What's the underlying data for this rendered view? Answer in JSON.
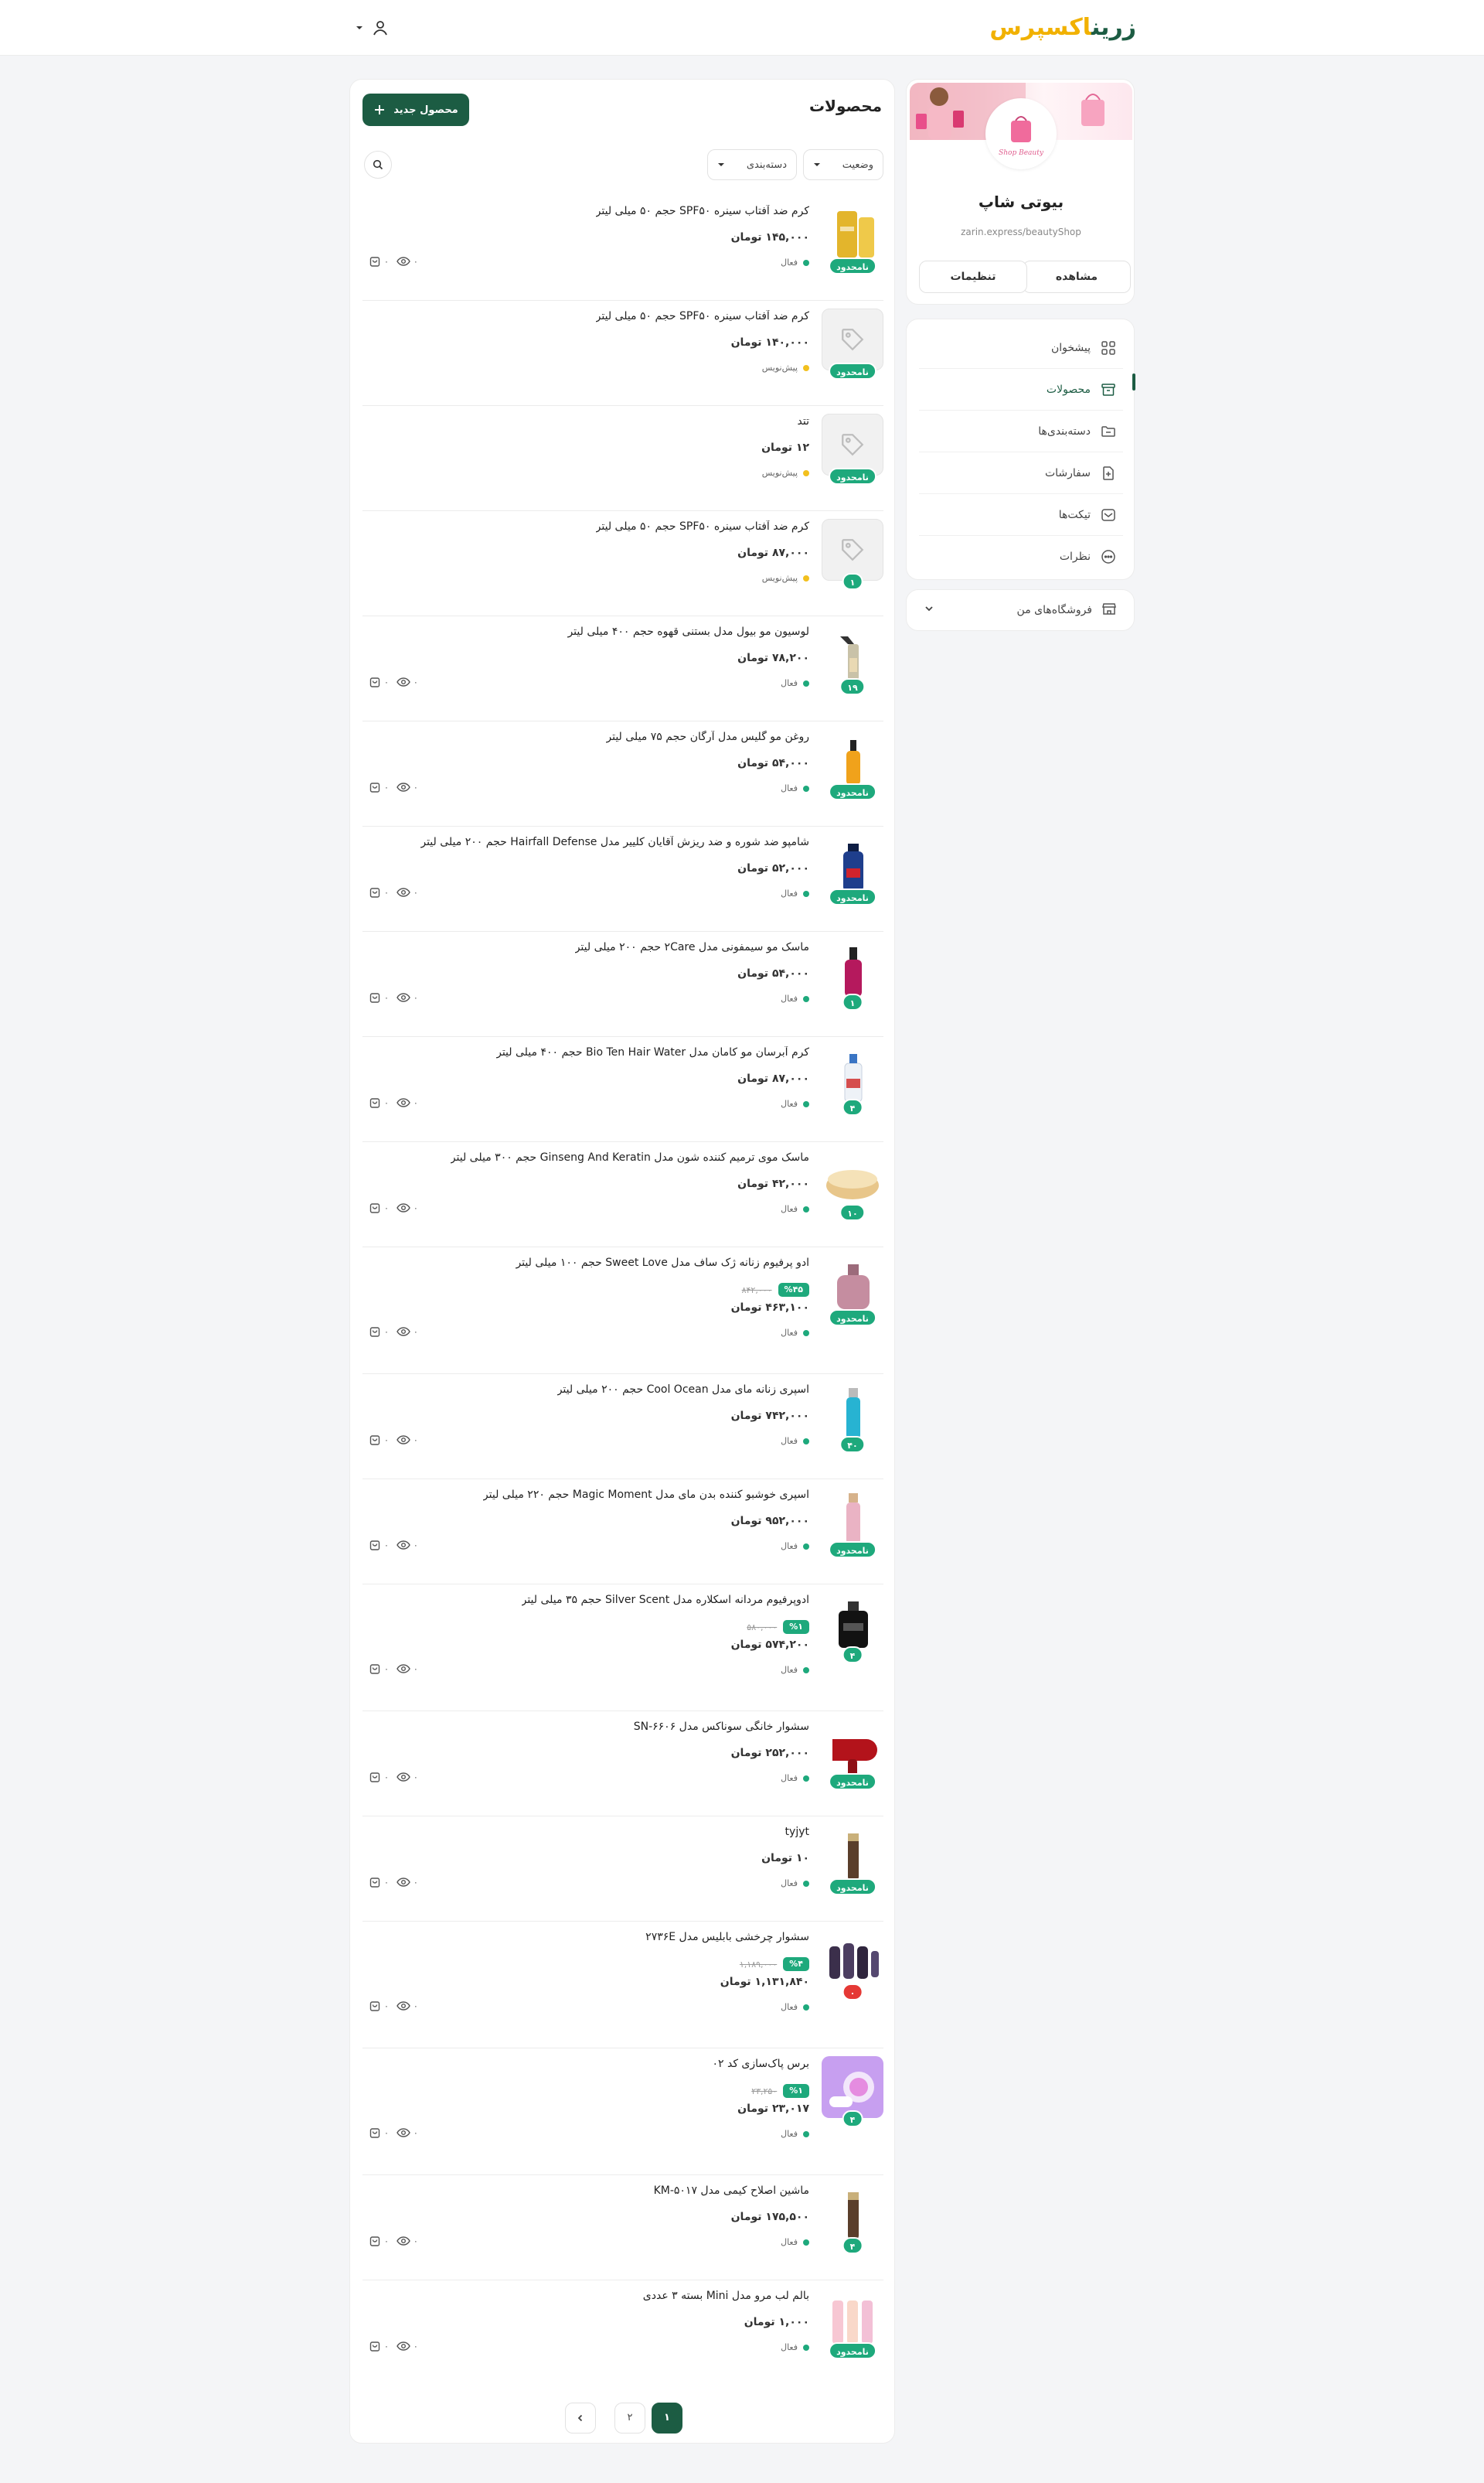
{
  "header": {
    "logo_part1": "زرین",
    "logo_part2": "اکسپرس"
  },
  "store": {
    "name": "بیوتی شاپ",
    "url": "zarin.express/beautyShop",
    "view_label": "مشاهده",
    "settings_label": "تنظیمات",
    "banner_script": "Shop Beauty"
  },
  "nav": {
    "items": [
      {
        "label": "پیشخوان",
        "icon": "grid-icon"
      },
      {
        "label": "محصولات",
        "icon": "box-icon"
      },
      {
        "label": "دسته‌بندی‌ها",
        "icon": "folder-icon"
      },
      {
        "label": "سفارشات",
        "icon": "document-icon"
      },
      {
        "label": "تیکت‌ها",
        "icon": "ticket-icon"
      },
      {
        "label": "نظرات",
        "icon": "comment-icon"
      }
    ],
    "my_stores_label": "فروشگاه‌های من"
  },
  "main": {
    "title": "محصولات",
    "new_product_label": "محصول جدید",
    "filter_status": "وضعیت",
    "filter_category": "دسته‌بندی"
  },
  "products": [
    {
      "name": "کرم ضد آفتاب سینره SPF۵۰ حجم ۵۰ میلی لیتر",
      "price": "۱۴۵,۰۰۰ تومان",
      "status": "فعال",
      "state": "active",
      "badge": "نامحدود",
      "thumb": "tubes",
      "views": "۰",
      "sales": "۰",
      "stats": true
    },
    {
      "name": "کرم ضد آفتاب سینره SPF۵۰ حجم ۵۰ میلی لیتر",
      "price": "۱۴۰,۰۰۰ تومان",
      "status": "پیش‌نویس",
      "state": "draft",
      "badge": "نامحدود",
      "thumb": "placeholder",
      "stats": false
    },
    {
      "name": "تتد",
      "price": "۱۲ تومان",
      "status": "پیش‌نویس",
      "state": "draft",
      "badge": "نامحدود",
      "thumb": "placeholder",
      "stats": false
    },
    {
      "name": "کرم ضد آفتاب سینره SPF۵۰ حجم ۵۰ میلی لیتر",
      "price": "۸۷,۰۰۰ تومان",
      "status": "پیش‌نویس",
      "state": "draft",
      "badge": "۱",
      "thumb": "placeholder",
      "stats": false
    },
    {
      "name": "لوسیون مو بیول مدل بستنی قهوه حجم ۴۰۰ میلی لیتر",
      "price": "۷۸,۲۰۰ تومان",
      "status": "فعال",
      "state": "active",
      "badge": "۱۹",
      "thumb": "spray",
      "views": "۰",
      "sales": "۰",
      "stats": true
    },
    {
      "name": "روغن مو گلیس مدل آرگان حجم ۷۵ میلی لیتر",
      "price": "۵۴,۰۰۰ تومان",
      "status": "فعال",
      "state": "active",
      "badge": "نامحدود",
      "thumb": "oil",
      "views": "۰",
      "sales": "۰",
      "stats": true
    },
    {
      "name": "شامپو ضد شوره و ضد ریزش آقایان کلییر مدل Hairfall Defense حجم ۲۰۰ میلی لیتر",
      "price": "۵۲,۰۰۰ تومان",
      "status": "فعال",
      "state": "active",
      "badge": "نامحدود",
      "thumb": "shampoo",
      "views": "۰",
      "sales": "۰",
      "stats": true
    },
    {
      "name": "ماسک مو سیمفونی مدل ۲Care حجم ۲۰۰ میلی لیتر",
      "price": "۵۴,۰۰۰ تومان",
      "status": "فعال",
      "state": "active",
      "badge": "۱",
      "thumb": "pink-bottle",
      "views": "۰",
      "sales": "۰",
      "stats": true
    },
    {
      "name": "کرم آبرسان مو کامان مدل Bio Ten Hair Water حجم ۴۰۰ میلی لیتر",
      "price": "۸۷,۰۰۰ تومان",
      "status": "فعال",
      "state": "active",
      "badge": "۴",
      "thumb": "white-bottle",
      "views": "۰",
      "sales": "۰",
      "stats": true
    },
    {
      "name": "ماسک موی ترمیم کننده شون مدل Ginseng And Keratin حجم ۳۰۰ میلی لیتر",
      "price": "۴۲,۰۰۰ تومان",
      "status": "فعال",
      "state": "active",
      "badge": "۱۰",
      "thumb": "jar",
      "views": "۰",
      "sales": "۰",
      "stats": true
    },
    {
      "name": "ادو پرفیوم زنانه ژک ساف مدل Sweet Love حجم ۱۰۰ میلی لیتر",
      "discount": "%۴۵",
      "old_price": "۸۴۲,۰۰۰",
      "price": "۴۶۳,۱۰۰ تومان",
      "status": "فعال",
      "state": "active",
      "badge": "نامحدود",
      "thumb": "perfume-pink",
      "views": "۰",
      "sales": "۰",
      "stats": true
    },
    {
      "name": "اسپری زنانه مای مدل Cool Ocean حجم ۲۰۰ میلی لیتر",
      "price": "۷۴۲,۰۰۰ تومان",
      "status": "فعال",
      "state": "active",
      "badge": "۴۰",
      "thumb": "blue-spray",
      "views": "۰",
      "sales": "۰",
      "stats": true
    },
    {
      "name": "اسپری خوشبو کننده بدن مای مدل Magic Moment حجم ۲۲۰ میلی لیتر",
      "price": "۹۵۲,۰۰۰ تومان",
      "status": "فعال",
      "state": "active",
      "badge": "نامحدود",
      "thumb": "pink-spray",
      "views": "۰",
      "sales": "۰",
      "stats": true
    },
    {
      "name": "ادوپرفیوم مردانه اسکلاره مدل Silver Scent حجم ۳۵ میلی لیتر",
      "discount": "%۱",
      "old_price": "۵۸۰,۰۰۰",
      "price": "۵۷۴,۲۰۰ تومان",
      "status": "فعال",
      "state": "active",
      "badge": "۴",
      "thumb": "black-perfume",
      "views": "۰",
      "sales": "۰",
      "stats": true
    },
    {
      "name": "سشوار خانگی سوناکس مدل SN-۶۶۰۶",
      "price": "۲۵۲,۰۰۰ تومان",
      "status": "فعال",
      "state": "active",
      "badge": "نامحدود",
      "thumb": "hairdryer",
      "views": "۰",
      "sales": "۰",
      "stats": true
    },
    {
      "name": "tyjyt",
      "price": "۱۰ تومان",
      "status": "فعال",
      "state": "active",
      "badge": "نامحدود",
      "thumb": "trimmer",
      "views": "۰",
      "sales": "۰",
      "stats": true
    },
    {
      "name": "سشوار چرخشی بابلیس مدل ۲۷۳۶E",
      "discount": "%۴",
      "old_price": "۱,۱۸۹,۰۰۰",
      "price": "۱,۱۳۱,۸۴۰ تومان",
      "status": "فعال",
      "state": "active",
      "badge": "۰",
      "badge_red": true,
      "thumb": "brushes",
      "views": "۰",
      "sales": "۰",
      "stats": true
    },
    {
      "name": "برس پاک‌سازی کد ۰۲",
      "discount": "%۱",
      "old_price": "۲۳,۲۵۰",
      "price": "۲۳,۰۱۷ تومان",
      "status": "فعال",
      "state": "active",
      "badge": "۴",
      "thumb": "cleansing-brush",
      "views": "۰",
      "sales": "۰",
      "stats": true
    },
    {
      "name": "ماشین اصلاح کیمی مدل KM-۵۰۱۷",
      "price": "۱۷۵,۵۰۰ تومان",
      "status": "فعال",
      "state": "active",
      "badge": "۴",
      "thumb": "trimmer",
      "views": "۰",
      "sales": "۰",
      "stats": true
    },
    {
      "name": "بالم لب مرو مدل Mini بسته ۳ عددی",
      "price": "۱,۰۰۰ تومان",
      "status": "فعال",
      "state": "active",
      "badge": "نامحدود",
      "thumb": "lipbalms",
      "views": "۰",
      "sales": "۰",
      "stats": true
    }
  ],
  "pagination": {
    "pages": [
      "۱",
      "۲"
    ],
    "current": "۱"
  }
}
